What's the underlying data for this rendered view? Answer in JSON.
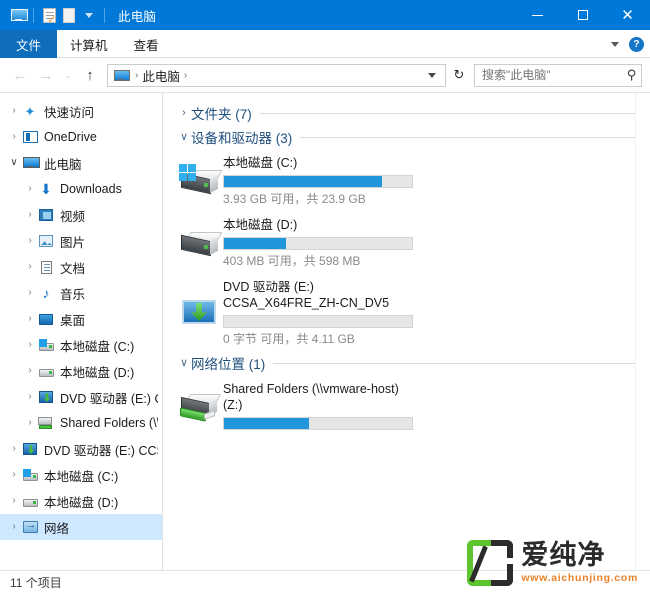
{
  "window": {
    "title": "此电脑",
    "quick_access_icons": [
      "monitor-icon",
      "properties-icon",
      "new-folder-icon",
      "customize-caret-icon"
    ],
    "controls": {
      "minimize": "—",
      "maximize": "□",
      "close": "✕"
    },
    "accent_color": "#0078d7"
  },
  "ribbon": {
    "tabs": [
      {
        "label": "文件",
        "active": true
      },
      {
        "label": "计算机",
        "active": false
      },
      {
        "label": "查看",
        "active": false
      }
    ],
    "collapse_icon": "chevron-down-icon",
    "help_label": "?"
  },
  "address": {
    "back": "←",
    "forward": "→",
    "recent": "⌄",
    "up": "↑",
    "crumb_icon": "this-pc-icon",
    "crumbs": [
      "此电脑"
    ],
    "separator": "›",
    "refresh": "↻",
    "dropdown_icon": "chevron-down-icon"
  },
  "search": {
    "placeholder": "搜索\"此电脑\"",
    "value": "",
    "icon": "search-icon"
  },
  "sidebar": {
    "items": [
      {
        "label": "快速访问",
        "icon": "star-icon",
        "expander": "›",
        "indent": 0,
        "selected": false
      },
      {
        "label": "OneDrive",
        "icon": "onedrive-icon",
        "expander": "›",
        "indent": 0,
        "selected": false
      },
      {
        "label": "此电脑",
        "icon": "this-pc-icon",
        "expander": "⌄",
        "indent": 0,
        "selected": false
      },
      {
        "label": "Downloads",
        "icon": "downloads-icon",
        "expander": "›",
        "indent": 1,
        "selected": false
      },
      {
        "label": "视频",
        "icon": "videos-icon",
        "expander": "›",
        "indent": 1,
        "selected": false
      },
      {
        "label": "图片",
        "icon": "pictures-icon",
        "expander": "›",
        "indent": 1,
        "selected": false
      },
      {
        "label": "文档",
        "icon": "documents-icon",
        "expander": "›",
        "indent": 1,
        "selected": false
      },
      {
        "label": "音乐",
        "icon": "music-icon",
        "expander": "›",
        "indent": 1,
        "selected": false
      },
      {
        "label": "桌面",
        "icon": "desktop-icon",
        "expander": "›",
        "indent": 1,
        "selected": false
      },
      {
        "label": "本地磁盘 (C:)",
        "icon": "windows-drive-icon",
        "expander": "›",
        "indent": 1,
        "selected": false
      },
      {
        "label": "本地磁盘 (D:)",
        "icon": "hard-drive-icon",
        "expander": "›",
        "indent": 1,
        "selected": false
      },
      {
        "label": "DVD 驱动器 (E:) CC",
        "icon": "dvd-drive-icon",
        "expander": "›",
        "indent": 1,
        "selected": false
      },
      {
        "label": "Shared Folders (\\\\",
        "icon": "network-drive-icon",
        "expander": "›",
        "indent": 1,
        "selected": false
      },
      {
        "label": "DVD 驱动器 (E:) CCS",
        "icon": "dvd-drive-icon",
        "expander": "›",
        "indent": 0,
        "selected": false
      },
      {
        "label": "本地磁盘 (C:)",
        "icon": "windows-drive-icon",
        "expander": "›",
        "indent": 0,
        "selected": false
      },
      {
        "label": "本地磁盘 (D:)",
        "icon": "hard-drive-icon",
        "expander": "›",
        "indent": 0,
        "selected": false
      },
      {
        "label": "网络",
        "icon": "network-icon",
        "expander": "›",
        "indent": 0,
        "selected": true
      }
    ]
  },
  "content": {
    "groups": [
      {
        "title": "文件夹 (7)",
        "count": 7,
        "collapsed": true,
        "chevron": "›",
        "items": []
      },
      {
        "title": "设备和驱动器 (3)",
        "count": 3,
        "collapsed": false,
        "chevron": "⌄",
        "items": [
          {
            "name": "本地磁盘 (C:)",
            "subname": "",
            "icon": "windows-hard-drive-icon",
            "free_text": "3.93 GB 可用，共 23.9 GB",
            "used_percent": 84,
            "bar_color": "#2196dd"
          },
          {
            "name": "本地磁盘 (D:)",
            "subname": "",
            "icon": "hard-drive-icon",
            "free_text": "403 MB 可用，共 598 MB",
            "used_percent": 33,
            "bar_color": "#2196dd"
          },
          {
            "name": "DVD 驱动器 (E:)",
            "subname": "CCSA_X64FRE_ZH-CN_DV5",
            "icon": "dvd-drive-icon",
            "free_text": "0 字节 可用，共 4.11 GB",
            "used_percent": 0,
            "bar_color": "#2196dd"
          }
        ]
      },
      {
        "title": "网络位置 (1)",
        "count": 1,
        "collapsed": false,
        "chevron": "⌄",
        "items": [
          {
            "name": "Shared Folders (\\\\vmware-host)",
            "subname": "(Z:)",
            "icon": "network-drive-icon",
            "free_text": "",
            "used_percent": 45,
            "bar_color": "#2196dd"
          }
        ]
      }
    ]
  },
  "statusbar": {
    "text": "11 个项目"
  },
  "watermark": {
    "brand": "爱纯净",
    "url": "www.aichunjing.com",
    "mark_color": "#5fc52e",
    "url_color": "#e8832a"
  }
}
